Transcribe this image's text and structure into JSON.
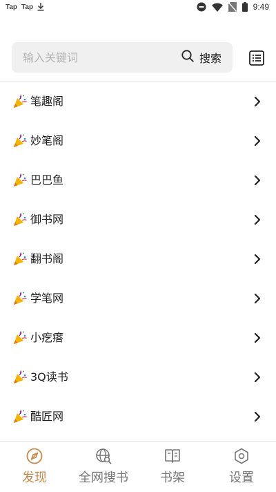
{
  "status_bar": {
    "left_icons": [
      "taptap-notification",
      "taptap-notification",
      "download-icon"
    ],
    "left_texts": [
      "Tap",
      "Tap"
    ],
    "time": "9:49",
    "right_icons": [
      "do-not-disturb-icon",
      "wifi-icon",
      "no-sim-icon",
      "battery-icon"
    ]
  },
  "search": {
    "placeholder": "输入关键词",
    "value": "",
    "button_label": "搜索"
  },
  "sites": [
    {
      "label": "笔趣阁",
      "icon": "party-popper-icon"
    },
    {
      "label": "妙笔阁",
      "icon": "party-popper-icon"
    },
    {
      "label": "巴巴鱼",
      "icon": "party-popper-icon"
    },
    {
      "label": "御书网",
      "icon": "party-popper-icon"
    },
    {
      "label": "翻书阁",
      "icon": "party-popper-icon"
    },
    {
      "label": "学笔网",
      "icon": "party-popper-icon"
    },
    {
      "label": "小疙瘩",
      "icon": "party-popper-icon"
    },
    {
      "label": "3Q读书",
      "icon": "party-popper-icon"
    },
    {
      "label": "酷匠网",
      "icon": "party-popper-icon"
    }
  ],
  "nav": {
    "items": [
      {
        "label": "发现",
        "icon": "discover-icon",
        "active": true
      },
      {
        "label": "全网搜书",
        "icon": "globe-search-icon",
        "active": false
      },
      {
        "label": "书架",
        "icon": "bookshelf-icon",
        "active": false
      },
      {
        "label": "设置",
        "icon": "settings-icon",
        "active": false
      }
    ]
  },
  "colors": {
    "accent": "#c8894a",
    "inactive": "#777777",
    "search_bg": "#f0f0f0",
    "divider": "#e6e6e6"
  }
}
